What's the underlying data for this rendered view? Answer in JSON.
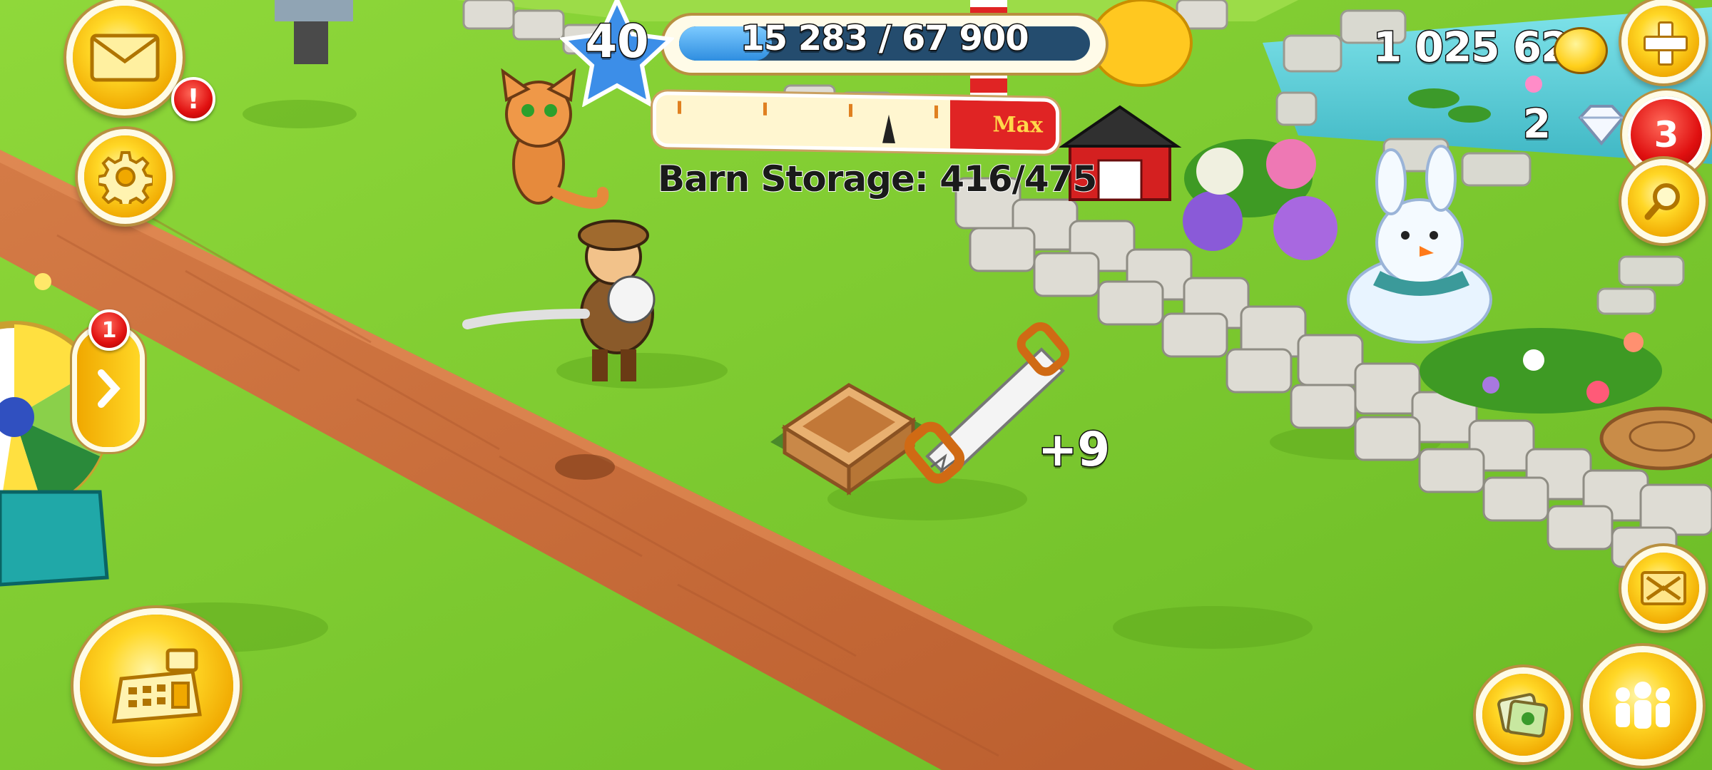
{
  "hud": {
    "level": "40",
    "xp_text": "15 283 / 67 900",
    "xp_progress": 0.225,
    "coins": "1 025 628",
    "diamonds": "2",
    "notification_count": "3"
  },
  "barn": {
    "meter_max_label": "Max",
    "storage_text": "Barn Storage: 416/475",
    "fill_fraction": 0.876
  },
  "left_menu": {
    "mail_alert": "!",
    "wheel_badge": "1"
  },
  "field": {
    "harvest_bonus": "+9"
  },
  "icons": [
    "mail-icon",
    "gear-icon",
    "cash-register-icon",
    "chevron-right-icon",
    "plus-icon",
    "magnifier-icon",
    "gold-coin-icon",
    "diamond-icon",
    "map-expand-icon",
    "friends-icon",
    "cards-icon",
    "saw-icon"
  ],
  "colors": {
    "gold": "#ffd726",
    "accent_red": "#e01010",
    "xp_blue": "#2f8ee0",
    "dirt": "#c86a38",
    "grass": "#7cc630"
  }
}
